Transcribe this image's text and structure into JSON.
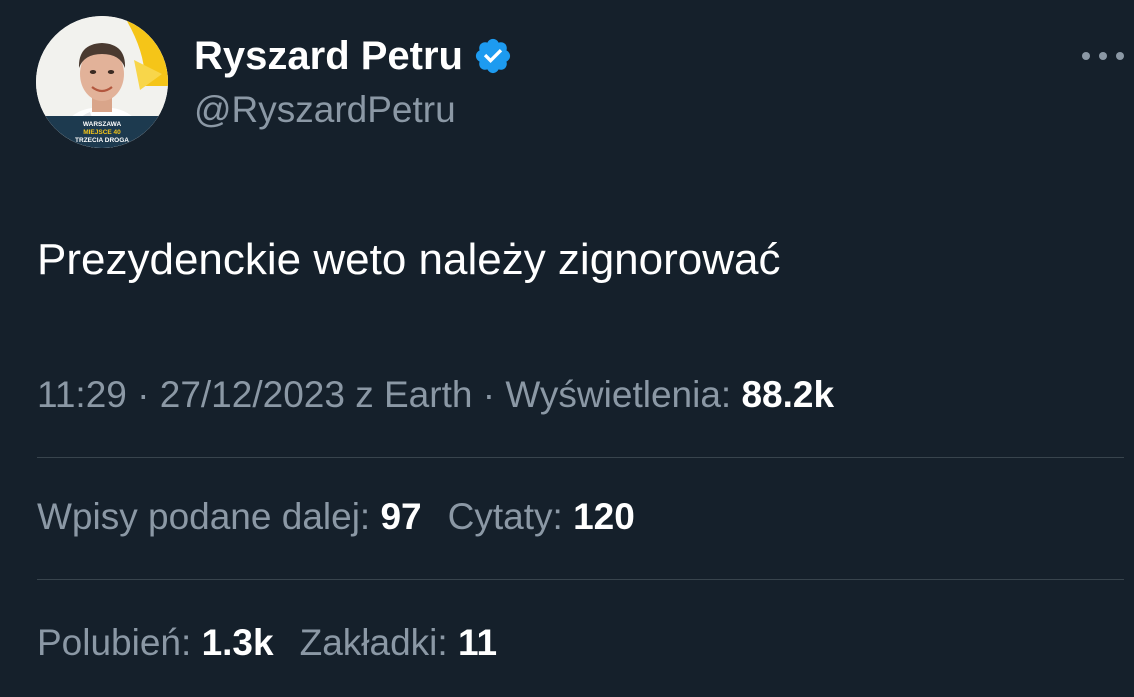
{
  "author": {
    "display_name": "Ryszard Petru",
    "handle": "@RyszardPetru",
    "verified_color": "#1d9bf0",
    "avatar_caption": {
      "line1": "WARSZAWA",
      "line2": "MIEJSCE 40",
      "line3": "TRZECIA DROGA"
    }
  },
  "tweet": {
    "text": "Prezydenckie weto należy zignorować",
    "time": "11:29",
    "separator": "·",
    "date": "27/12/2023",
    "source": "z Earth",
    "views_label": "Wyświetlenia:",
    "views_value": "88.2k"
  },
  "stats": {
    "retweets_label": "Wpisy podane dalej:",
    "retweets_value": "97",
    "quotes_label": "Cytaty:",
    "quotes_value": "120",
    "likes_label": "Polubień:",
    "likes_value": "1.3k",
    "bookmarks_label": "Zakładki:",
    "bookmarks_value": "11"
  },
  "icons": {
    "more": "more-horizontal-icon",
    "verified": "verified-badge-icon"
  },
  "colors": {
    "background": "#15202b",
    "primary_text": "#ffffff",
    "secondary_text": "#8b98a5",
    "divider": "#38444d"
  }
}
